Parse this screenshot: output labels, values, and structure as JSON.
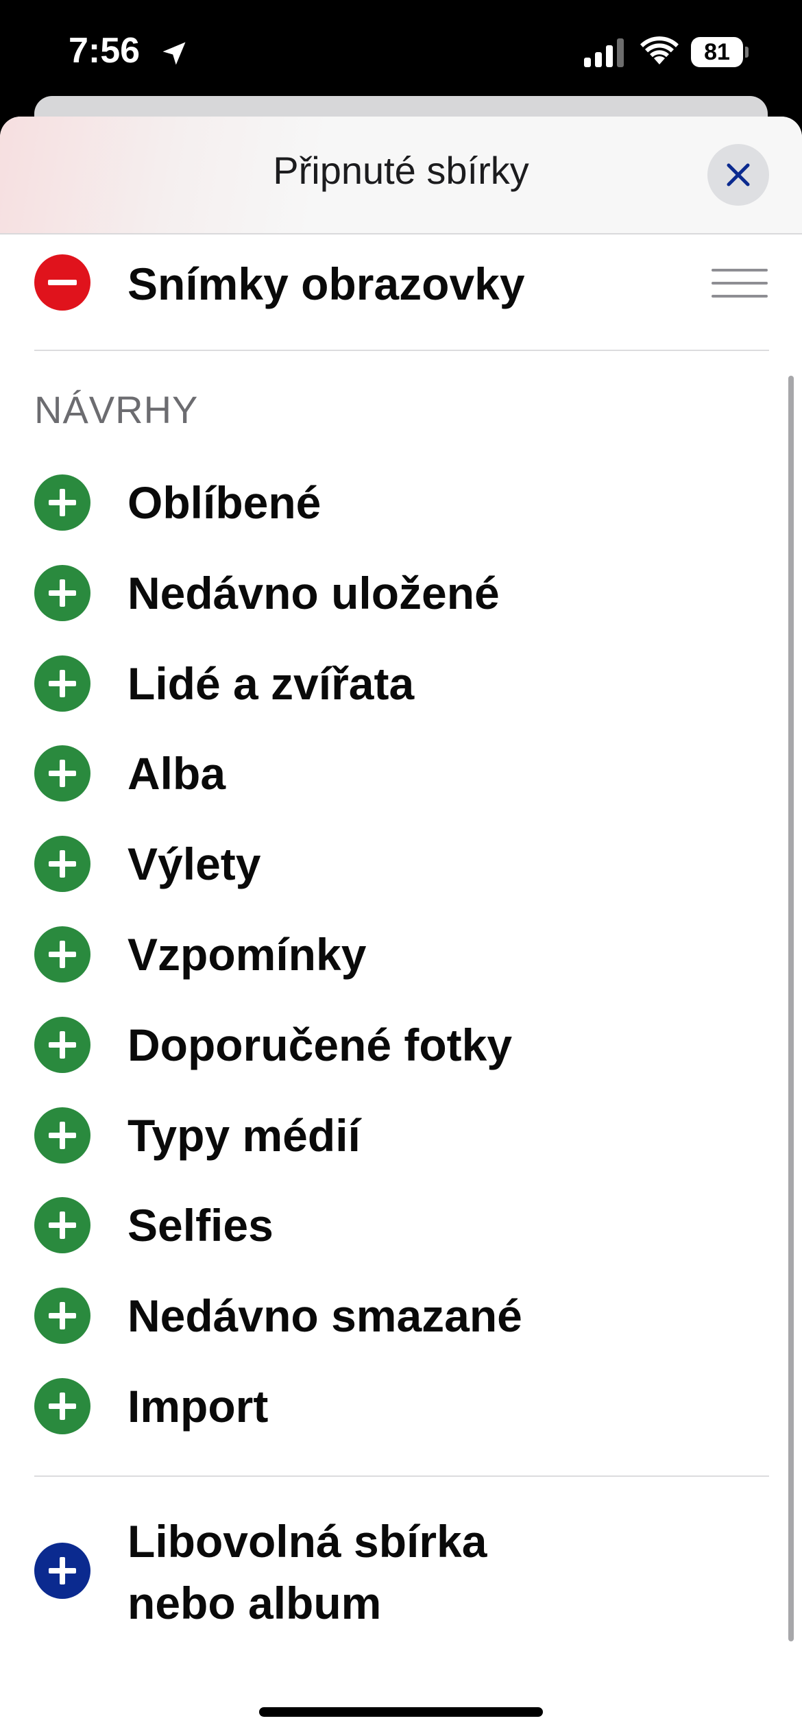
{
  "status_bar": {
    "time": "7:56",
    "battery": "81",
    "icons": [
      "location-arrow-icon",
      "cellular-signal-icon",
      "wifi-icon",
      "battery-icon"
    ]
  },
  "sheet": {
    "title": "Připnuté sbírky",
    "close_icon": "close-icon"
  },
  "pinned": [
    {
      "label": "Snímky obrazovky",
      "action_icon": "remove-icon",
      "handle_icon": "reorder-handle-icon",
      "color": "#e0131c"
    }
  ],
  "suggestions": {
    "header": "NÁVRHY",
    "items": [
      {
        "label": "Oblíbené"
      },
      {
        "label": "Nedávno uložené"
      },
      {
        "label": "Lidé a zvířata"
      },
      {
        "label": "Alba"
      },
      {
        "label": "Výlety"
      },
      {
        "label": "Vzpomínky"
      },
      {
        "label": "Doporučené fotky"
      },
      {
        "label": "Typy médií"
      },
      {
        "label": "Selfies"
      },
      {
        "label": "Nedávno smazané"
      },
      {
        "label": "Import"
      }
    ],
    "add_color": "#2a8a3e"
  },
  "custom": {
    "line1": "Libovolná sbírka",
    "line2": "nebo album",
    "color": "#0b2a8f"
  }
}
